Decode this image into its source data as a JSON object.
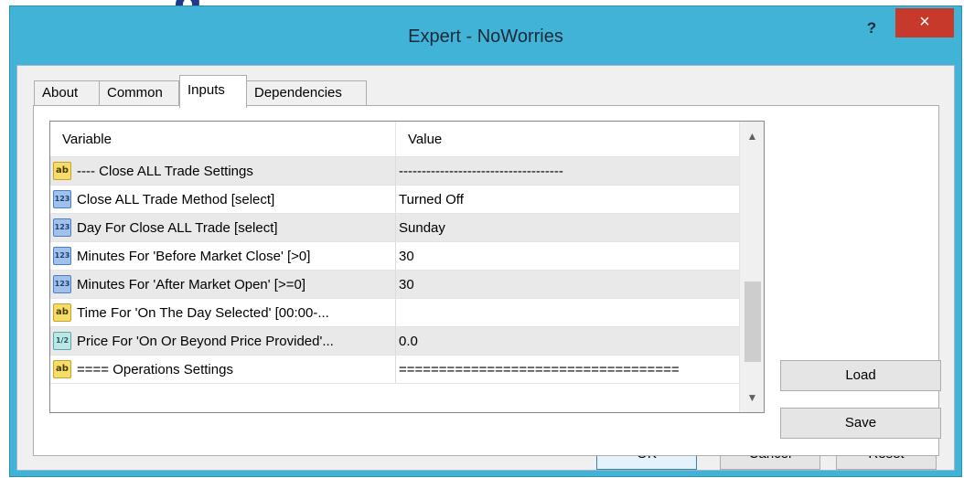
{
  "window": {
    "title": "Expert - NoWorries",
    "help_label": "?",
    "close_label": "×"
  },
  "tabs": [
    {
      "label": "About"
    },
    {
      "label": "Common"
    },
    {
      "label": "Inputs",
      "active": true
    },
    {
      "label": "Dependencies"
    }
  ],
  "grid": {
    "headers": {
      "variable": "Variable",
      "value": "Value"
    },
    "rows": [
      {
        "icon": "ab",
        "variable": "---- Close ALL Trade Settings",
        "value": "------------------------------------"
      },
      {
        "icon": "123",
        "variable": "Close ALL Trade Method [select]",
        "value": "Turned Off"
      },
      {
        "icon": "123",
        "variable": "Day For Close ALL Trade [select]",
        "value": "Sunday"
      },
      {
        "icon": "123",
        "variable": "Minutes For 'Before Market Close' [>0]",
        "value": "30"
      },
      {
        "icon": "123",
        "variable": "Minutes For 'After Market Open' [>=0]",
        "value": "30"
      },
      {
        "icon": "ab",
        "variable": "Time For 'On The Day Selected' [00:00-...",
        "value": ""
      },
      {
        "icon": "1/2",
        "variable": "Price For 'On Or Beyond Price Provided'...",
        "value": "0.0"
      },
      {
        "icon": "ab",
        "variable": "==== Operations Settings",
        "value": "==================================="
      }
    ]
  },
  "side_buttons": {
    "load": "Load",
    "save": "Save"
  },
  "footer_buttons": {
    "ok": "OK",
    "cancel": "Cancel",
    "reset": "Reset"
  },
  "background_text": "g"
}
